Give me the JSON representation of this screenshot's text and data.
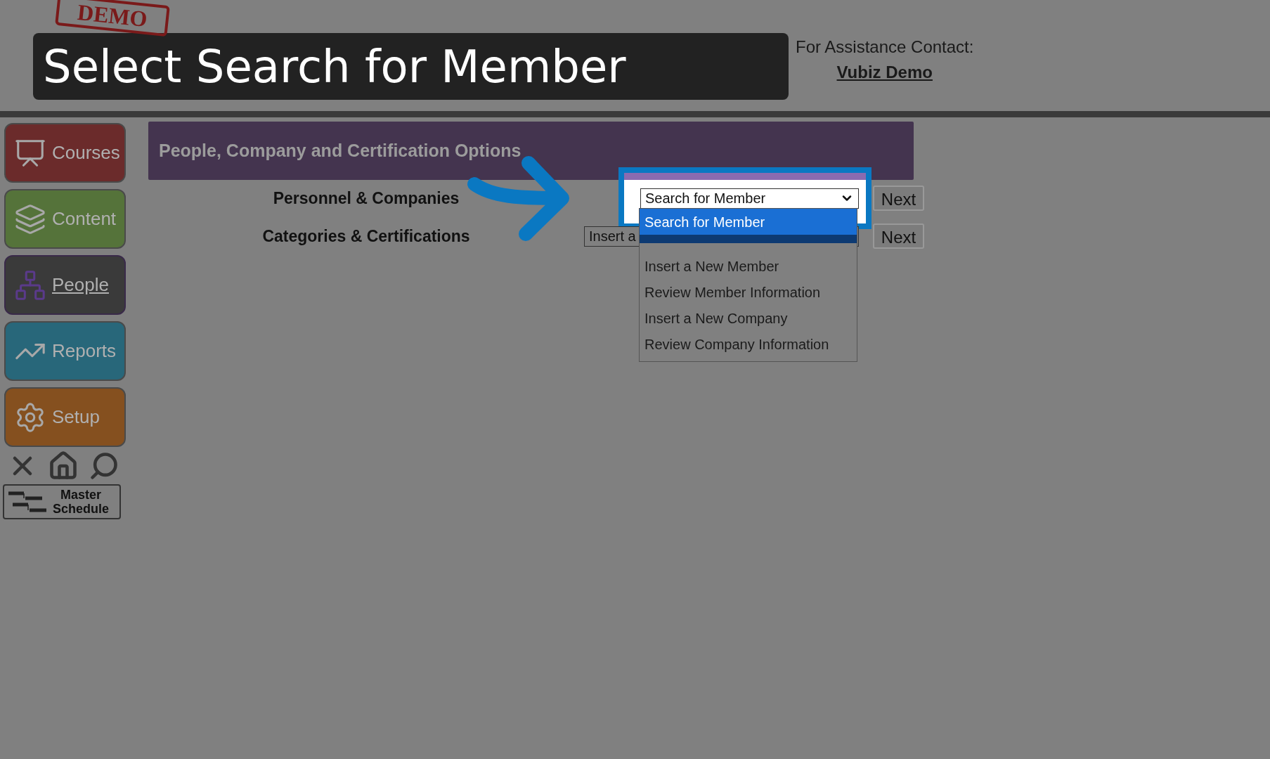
{
  "logo": {
    "text": "DEMO"
  },
  "caption": "Select Search for Member",
  "contact": {
    "label": "For Assistance Contact:",
    "name": "Vubiz Demo"
  },
  "sidebar": {
    "items": [
      {
        "label": "Courses",
        "kind": "presentation",
        "color": "#6b2b2b",
        "selected": false
      },
      {
        "label": "Content",
        "kind": "books",
        "color": "#55733a",
        "selected": false
      },
      {
        "label": "People",
        "kind": "network",
        "color": "#3a3a3a",
        "selected": true
      },
      {
        "label": "Reports",
        "kind": "chart",
        "color": "#28677a",
        "selected": false
      },
      {
        "label": "Setup",
        "kind": "gears",
        "color": "#85501f",
        "selected": false
      }
    ]
  },
  "schedule_button": "Master Schedule",
  "panel": {
    "title": "People, Company and Certification Options",
    "rows": [
      {
        "label": "Personnel & Companies",
        "select": "Search for Member",
        "button": "Next"
      },
      {
        "label": "Categories & Certifications",
        "select": "Insert a",
        "button": "Next"
      }
    ]
  },
  "dropdown": {
    "options": [
      {
        "label": "Search for Member",
        "selected": true
      },
      {
        "label": "Insert a New Member",
        "selected": false
      },
      {
        "label": "Review Member Information",
        "selected": false
      },
      {
        "label": "Insert a New Company",
        "selected": false
      },
      {
        "label": "Review Company Information",
        "selected": false
      }
    ]
  }
}
